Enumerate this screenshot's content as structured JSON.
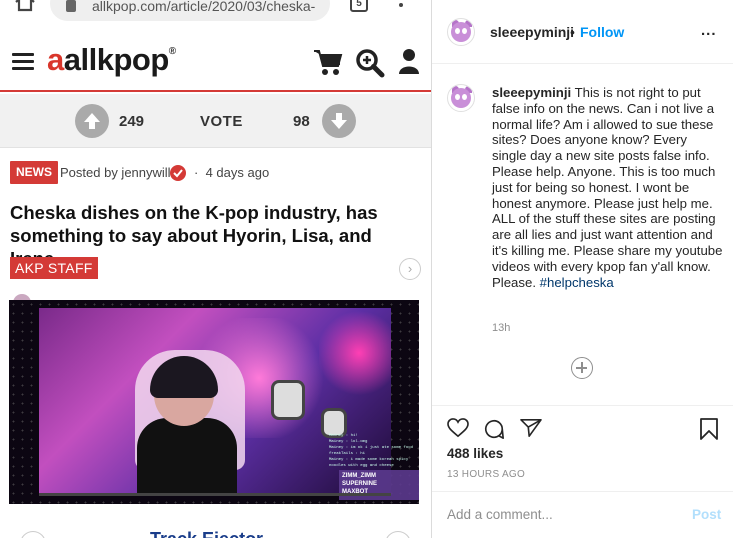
{
  "browser": {
    "url": "allkpop.com/article/2020/03/cheska-",
    "tab_count": "5",
    "icons": [
      "home-icon",
      "lock-icon",
      "tabs-icon",
      "more-vert-icon"
    ]
  },
  "site": {
    "logo_mark": "a",
    "logo_text": "allkpop",
    "logo_reg": "®",
    "icons": [
      "menu-icon",
      "cart-icon",
      "search-plus-icon",
      "user-icon"
    ]
  },
  "vote": {
    "up_count": "249",
    "label": "VOTE",
    "down_count": "98"
  },
  "article": {
    "category": "NEWS",
    "posted_by": "Posted by jennywill",
    "separator": "·",
    "time_ago": "4 days ago",
    "headline": "Cheska dishes on the K-pop industry, has something to say about Hyorin, Lisa, and Irene",
    "staff_badge": "AKP STAFF",
    "next_chevron": "›",
    "video": {
      "chat_lines": [
        "Mainey : hi!",
        "Mainey : lol.omg",
        "Mainey : im ok i just ate some food",
        "freakTails : hi",
        "Mainey : i made some korean spicy noodles with egg and cheese"
      ],
      "overlay_line1": "ZIMM_ZIMM",
      "overlay_line2": "SUPERNINE",
      "overlay_line3": "MAXBOT"
    },
    "next_title": "Track Ejector"
  },
  "instagram": {
    "username": "sleeepyminji",
    "dot": "•",
    "follow_label": "Follow",
    "more": "...",
    "caption_user": "sleeepyminji",
    "caption_text": "This is not right to put false info on the news. Can i not live a normal life? Am i allowed to sue these sites? Does anyone know? Every single day a new site posts false info. Please help. Anyone. This is too much just for being so honest. I wont be honest anymore. Please just help me. ALL of the stuff these sites are posting are all lies and just want attention and it's killing me. Please share my youtube videos with every kpop fan y'all know. Please.",
    "caption_hashtag": "#helpcheska",
    "caption_time": "13h",
    "likes": "488 likes",
    "post_date": "13 HOURS AGO",
    "comment_placeholder": "Add a comment...",
    "post_label": "Post",
    "colors": {
      "follow": "#0095f6",
      "post_disabled": "#b2dffc",
      "hashtag": "#00376b"
    }
  },
  "colors": {
    "brand_red": "#d43a36",
    "headline_blue": "#1a3d8a"
  }
}
